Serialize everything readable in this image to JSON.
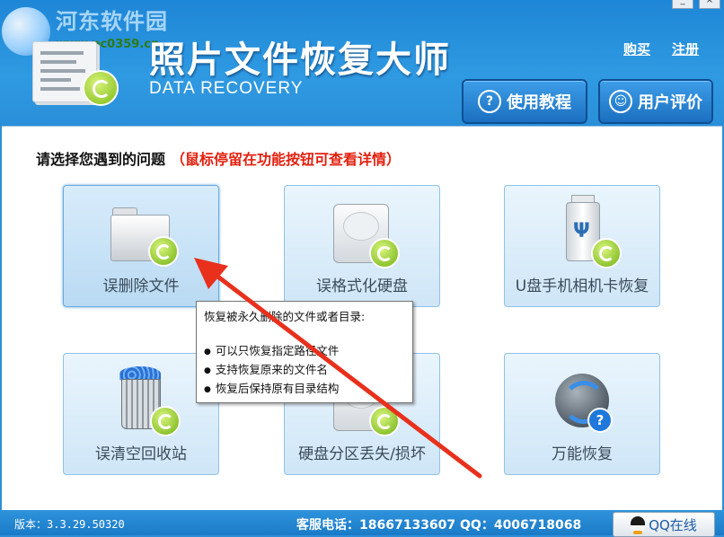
{
  "header": {
    "watermark": "河东软件园",
    "watermark_url": "www.pc0359.cn",
    "title": "照片文件恢复大师",
    "subtitle": "DATA RECOVERY",
    "links": {
      "buy": "购买",
      "register": "注册"
    },
    "buttons": {
      "tutorial": "使用教程",
      "review": "用户评价"
    },
    "window_controls": {
      "minimize": "_",
      "close": "×"
    }
  },
  "main": {
    "prompt": "请选择您遇到的问题",
    "hint": "（鼠标停留在功能按钮可查看详情）",
    "tiles": [
      {
        "label": "误删除文件",
        "icon": "folder-recover-icon"
      },
      {
        "label": "误格式化硬盘",
        "icon": "harddisk-recover-icon"
      },
      {
        "label": "U盘手机相机卡恢复",
        "icon": "usb-recover-icon"
      },
      {
        "label": "误清空回收站",
        "icon": "recycle-bin-recover-icon"
      },
      {
        "label": "硬盘分区丢失/损坏",
        "icon": "partition-recover-icon"
      },
      {
        "label": "万能恢复",
        "icon": "universal-recover-icon"
      }
    ],
    "tooltip": {
      "heading": "恢复被永久删除的文件或者目录:",
      "items": [
        "可以只恢复指定路径文件",
        "支持恢复原来的文件名",
        "恢复后保持原有目录结构"
      ]
    }
  },
  "footer": {
    "version": "版本：3.3.29.50320",
    "contact": "客服电话：18667133607  QQ：4006718068",
    "qq_button": "QQ在线"
  },
  "colors": {
    "accent": "#2d8fd8",
    "hint": "#e3200f",
    "arrow": "#e8301c"
  }
}
